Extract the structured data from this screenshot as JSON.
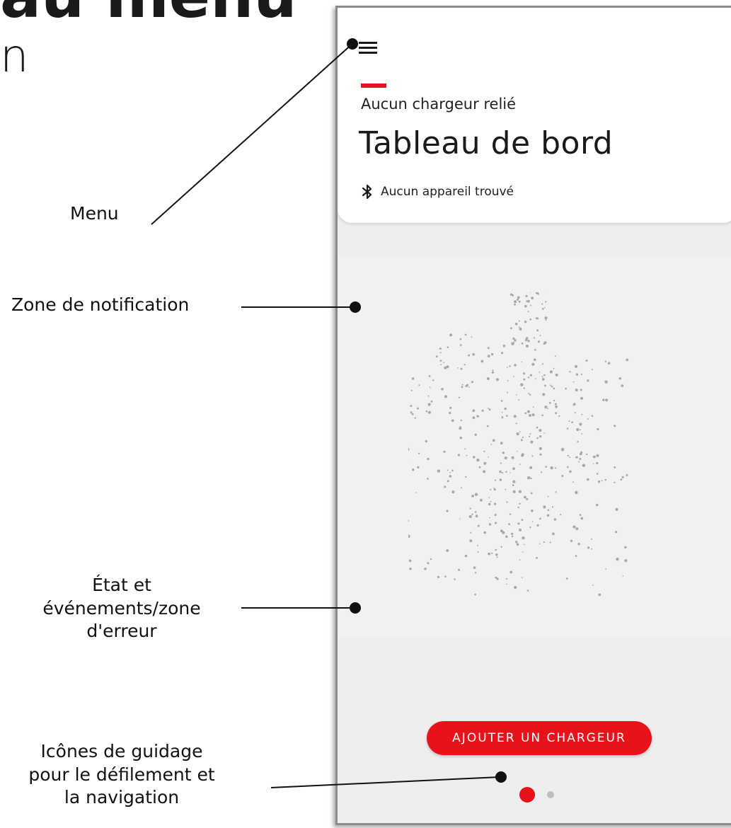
{
  "page_heading": {
    "fragment_line1": "au menu",
    "fragment_line2": "n"
  },
  "callouts": {
    "menu": "Menu",
    "notification_zone": "Zone de notification",
    "status_line1": "État et",
    "status_line2": "événements/zone",
    "status_line3": "d'erreur",
    "guidance_line1": "Icônes de guidage",
    "guidance_line2": "pour le défilement et",
    "guidance_line3": "la navigation"
  },
  "app": {
    "subtitle": "Aucun chargeur relié",
    "title": "Tableau de bord",
    "bluetooth_status": "Aucun appareil trouvé",
    "add_charger_button": "AJOUTER UN CHARGEUR",
    "pagination": {
      "total": 2,
      "active": 1
    }
  },
  "colors": {
    "accent_red": "#e8121b",
    "inactive_dot": "#bdbdbd",
    "notification_bg": "#f1f1f1"
  },
  "icons": {
    "menu": "hamburger-icon",
    "bluetooth": "bluetooth-icon"
  }
}
